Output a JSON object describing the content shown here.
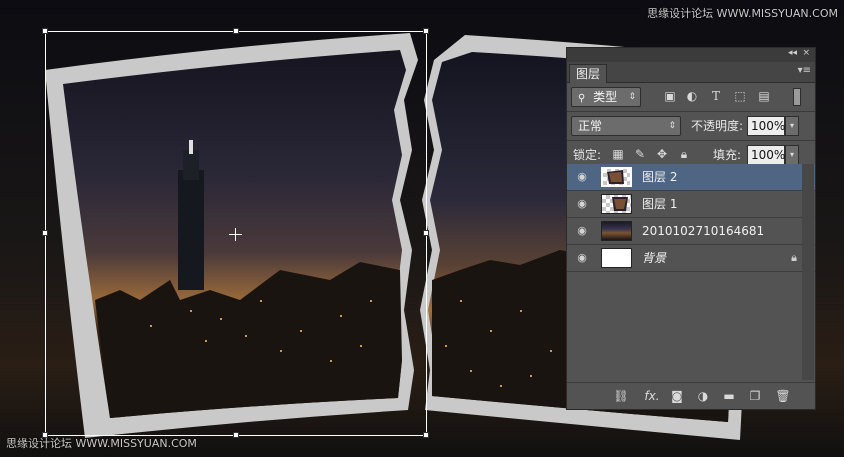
{
  "watermarks": {
    "top": "思缘设计论坛 WWW.MISSYUAN.COM",
    "bottom": "思缘设计论坛 WWW.MISSYUAN.COM"
  },
  "panel": {
    "collapse_glyph": "◂◂",
    "close_glyph": "×",
    "tab_label": "图层",
    "menu_glyph": "▾≡",
    "filter": {
      "search_icon": "search-icon",
      "value": "类型"
    },
    "filter_icons": [
      "image-filter-icon",
      "adjustment-filter-icon",
      "type-filter-icon",
      "shape-filter-icon",
      "smart-object-filter-icon",
      "toggle-filter-icon"
    ],
    "blend_mode": "正常",
    "opacity_label": "不透明度:",
    "opacity_value": "100%",
    "lock_label": "锁定:",
    "fill_label": "填充:",
    "fill_value": "100%",
    "layers": [
      {
        "name": "图层 2",
        "selected": true,
        "thumb": "checker"
      },
      {
        "name": "图层 1",
        "selected": false,
        "thumb": "checker"
      },
      {
        "name": "2010102710164681",
        "selected": false,
        "thumb": "photo"
      },
      {
        "name": "背景",
        "selected": false,
        "thumb": "white",
        "locked": true
      }
    ],
    "footer_icons": [
      "link-layers-icon",
      "fx-icon",
      "add-mask-icon",
      "adjustment-layer-icon",
      "new-group-icon",
      "new-layer-icon",
      "delete-icon"
    ],
    "fx_text": "fx."
  },
  "colors": {
    "panel_bg": "#535353",
    "selection": "#4e6584"
  }
}
